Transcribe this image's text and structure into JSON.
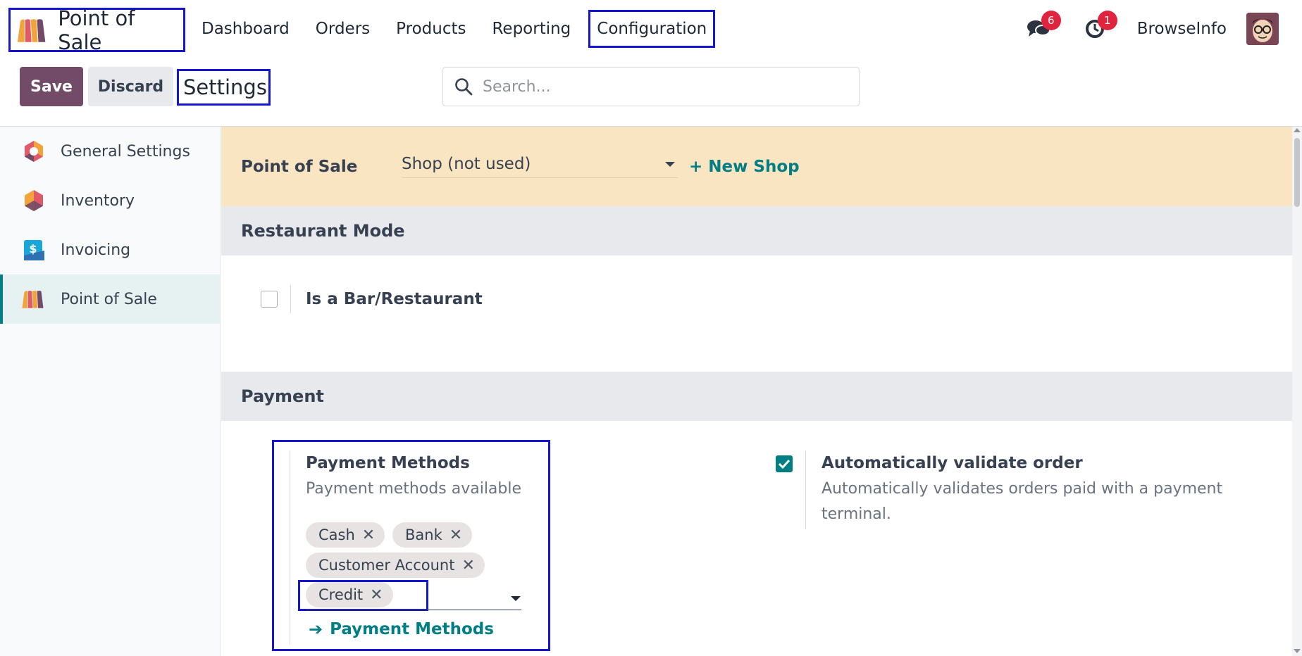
{
  "nav": {
    "app_name": "Point of Sale",
    "menu": [
      "Dashboard",
      "Orders",
      "Products",
      "Reporting",
      "Configuration"
    ],
    "messages_count": "6",
    "activities_count": "1",
    "user_name": "BrowseInfo"
  },
  "control_panel": {
    "save_label": "Save",
    "discard_label": "Discard",
    "title": "Settings",
    "search_placeholder": "Search..."
  },
  "sidebar": {
    "items": [
      {
        "label": "General Settings",
        "icon": "general-settings-icon"
      },
      {
        "label": "Inventory",
        "icon": "inventory-icon"
      },
      {
        "label": "Invoicing",
        "icon": "invoicing-icon"
      },
      {
        "label": "Point of Sale",
        "icon": "point-of-sale-icon",
        "active": true
      }
    ]
  },
  "content": {
    "pos_label": "Point of Sale",
    "shop_value": "Shop (not used)",
    "new_shop_label": "+ New Shop",
    "restaurant_section": "Restaurant Mode",
    "bar_restaurant_label": "Is a Bar/Restaurant",
    "bar_restaurant_checked": false,
    "payment_section": "Payment",
    "payment_methods": {
      "title": "Payment Methods",
      "description": "Payment methods available",
      "tags": [
        "Cash",
        "Bank",
        "Customer Account",
        "Credit"
      ],
      "link_label": "Payment Methods"
    },
    "auto_validate": {
      "title": "Automatically validate order",
      "description": "Automatically validates orders paid with a payment terminal.",
      "checked": true
    }
  },
  "colors": {
    "primary": "#714b67",
    "teal": "#017e84",
    "highlight_border": "#1515d6",
    "pos_bar": "#f9e5c1",
    "badge": "#e0243d"
  }
}
